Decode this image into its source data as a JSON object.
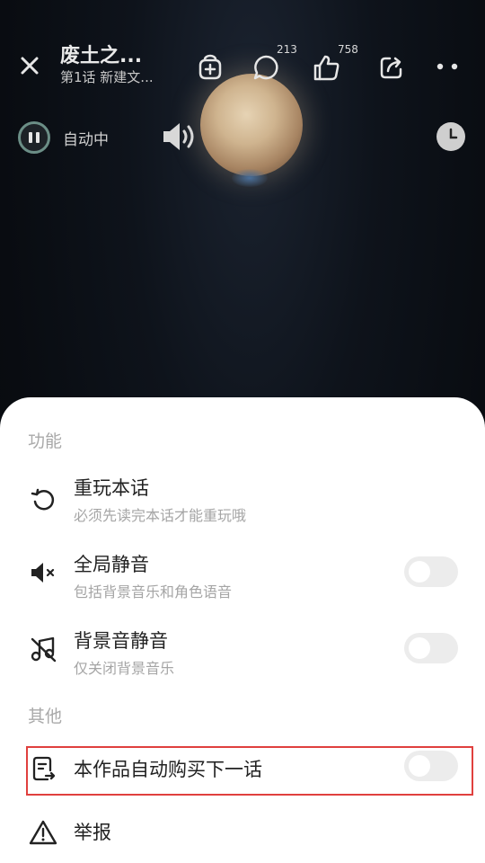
{
  "header": {
    "close_icon": "close-icon",
    "title": "废土之...",
    "subtitle": "第1话 新建文...",
    "comment_count": "213",
    "like_count": "758"
  },
  "player": {
    "autoplay_label": "自动中"
  },
  "sheet": {
    "section_function": "功能",
    "section_other": "其他",
    "items": [
      {
        "title": "重玩本话",
        "subtitle": "必须先读完本话才能重玩哦",
        "icon": "replay-icon"
      },
      {
        "title": "全局静音",
        "subtitle": "包括背景音乐和角色语音",
        "icon": "mute-icon",
        "toggle": false
      },
      {
        "title": "背景音静音",
        "subtitle": "仅关闭背景音乐",
        "icon": "music-off-icon",
        "toggle": false
      },
      {
        "title": "本作品自动购买下一话",
        "icon": "auto-buy-icon",
        "toggle": false
      },
      {
        "title": "举报",
        "icon": "warning-icon"
      }
    ]
  },
  "colors": {
    "highlight": "#e0403e",
    "toggle_off": "#ececec"
  }
}
